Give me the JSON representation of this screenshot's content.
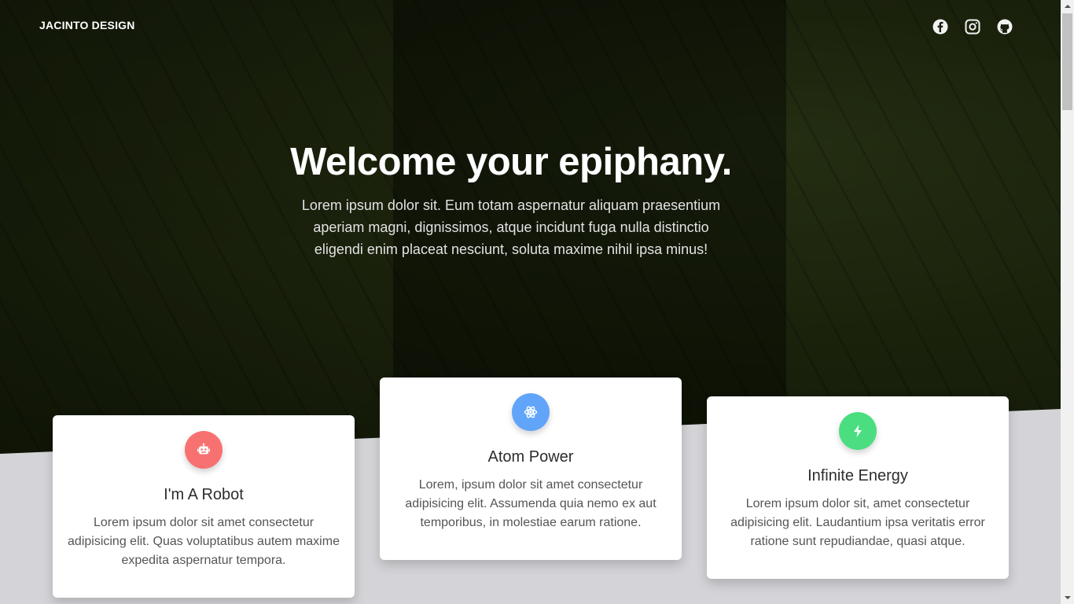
{
  "brand": "JACINTO DESIGN",
  "social": [
    {
      "name": "facebook-icon"
    },
    {
      "name": "instagram-icon"
    },
    {
      "name": "github-icon"
    }
  ],
  "hero": {
    "title": "Welcome your epiphany.",
    "text": "Lorem ipsum dolor sit. Eum totam aspernatur aliquam praesentium aperiam magni, dignissimos, atque incidunt fuga nulla distinctio eligendi enim placeat nesciunt, soluta maxime nihil ipsa minus!"
  },
  "cards": [
    {
      "title": "I'm A Robot",
      "text": "Lorem ipsum dolor sit amet consectetur adipisicing elit. Quas voluptatibus autem maxime expedita aspernatur tempora.",
      "icon": "robot-icon",
      "color": "#f87171"
    },
    {
      "title": "Atom Power",
      "text": "Lorem, ipsum dolor sit amet consectetur adipisicing elit. Assumenda quia nemo ex aut temporibus, in molestiae earum ratione.",
      "icon": "atom-icon",
      "color": "#60a5fa"
    },
    {
      "title": "Infinite Energy",
      "text": "Lorem ipsum dolor sit, amet consectetur adipisicing elit. Laudantium ipsa veritatis error ratione sunt repudiandae, quasi atque.",
      "icon": "lightning-bolt-icon",
      "color": "#4ade80"
    }
  ],
  "colors": {
    "page_background": "#d4d4d8",
    "hero_dark": "#1b230c"
  }
}
